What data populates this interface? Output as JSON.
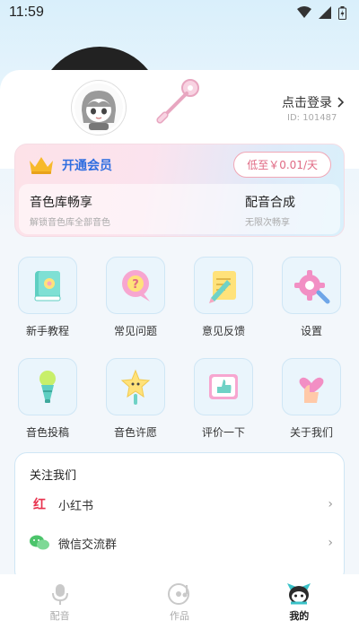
{
  "status_bar": {
    "time": "11:59"
  },
  "profile": {
    "login_label": "点击登录",
    "user_id": "ID: 101487"
  },
  "vip": {
    "title": "开通会员",
    "price": "低至￥0.01/天",
    "features": [
      {
        "title": "音色库畅享",
        "subtitle": "解锁音色库全部音色"
      },
      {
        "title": "配音合成",
        "subtitle": "无限次畅享"
      }
    ]
  },
  "menu": [
    {
      "label": "新手教程",
      "icon": "book-icon"
    },
    {
      "label": "常见问题",
      "icon": "question-bubble-icon"
    },
    {
      "label": "意见反馈",
      "icon": "feedback-note-icon"
    },
    {
      "label": "设置",
      "icon": "gear-icon"
    },
    {
      "label": "音色投稿",
      "icon": "microphone-icon"
    },
    {
      "label": "音色许愿",
      "icon": "star-wand-icon"
    },
    {
      "label": "评价一下",
      "icon": "thumbs-up-icon"
    },
    {
      "label": "关于我们",
      "icon": "heart-hand-icon"
    }
  ],
  "follow": {
    "title": "关注我们",
    "items": [
      {
        "label": "小红书",
        "icon": "xiaohongshu-icon",
        "icon_text": "红"
      },
      {
        "label": "微信交流群",
        "icon": "wechat-icon"
      }
    ]
  },
  "tabs": [
    {
      "label": "配音",
      "icon": "mic-tab-icon",
      "active": false
    },
    {
      "label": "作品",
      "icon": "music-disc-tab-icon",
      "active": false
    },
    {
      "label": "我的",
      "icon": "mascot-tab-icon",
      "active": true
    }
  ],
  "colors": {
    "accent_blue": "#2f6ee0",
    "price_pink": "#e06a84",
    "tile_bg": "#eaf5fc"
  }
}
